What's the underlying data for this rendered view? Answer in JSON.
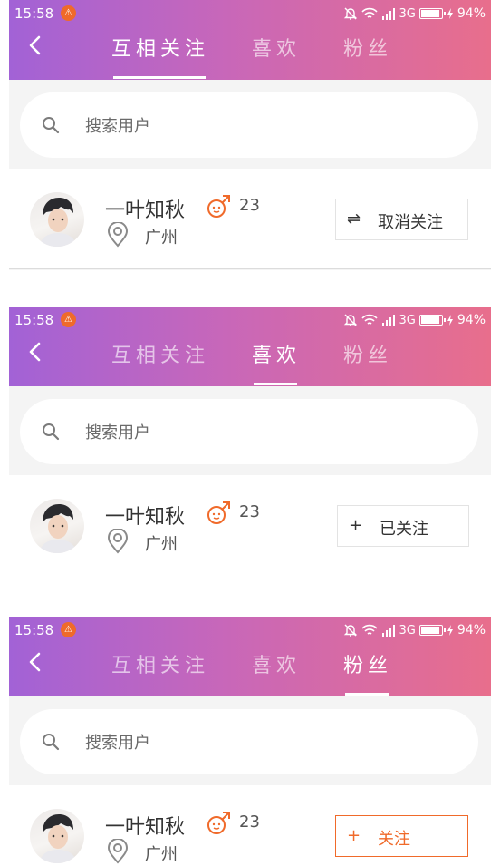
{
  "status": {
    "time": "15:58",
    "network": "3G",
    "battery": "94%",
    "battery_level": 0.94
  },
  "tabs": [
    "互相关注",
    "喜欢",
    "粉丝"
  ],
  "search": {
    "placeholder": "搜索用户"
  },
  "user": {
    "name": "一叶知秋",
    "age": "23",
    "city": "广州"
  },
  "screens": [
    {
      "active_tab": "互相关注",
      "button": {
        "icon": "⇌",
        "label": "取消关注"
      }
    },
    {
      "active_tab": "喜欢",
      "button": {
        "icon": "+",
        "label": "已关注"
      }
    },
    {
      "active_tab": "粉丝",
      "button": {
        "icon": "+",
        "label": "关注"
      }
    }
  ],
  "colors": {
    "gradient_start": "#a262d6",
    "gradient_end": "#e86e8c",
    "accent": "#f06a2a"
  },
  "icons": [
    "chevron-left-icon",
    "search-icon",
    "male-icon",
    "location-pin-icon",
    "warning-icon",
    "mute-icon",
    "wifi-icon",
    "signal-icon",
    "battery-icon",
    "charging-icon"
  ]
}
